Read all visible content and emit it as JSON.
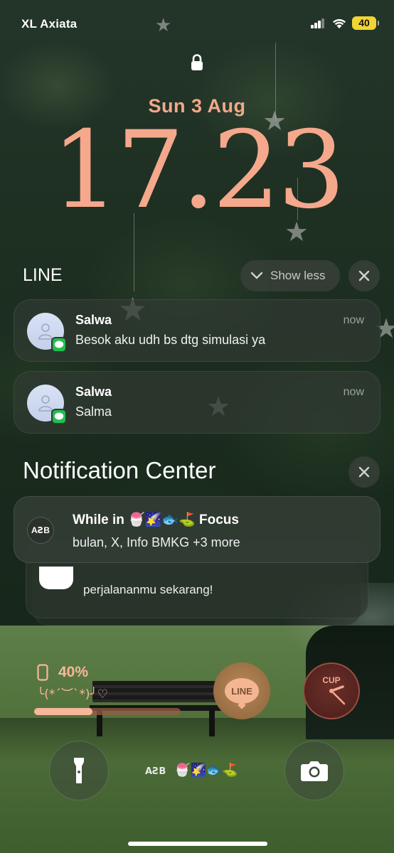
{
  "status_bar": {
    "carrier": "XL Axiata",
    "battery_level": "40"
  },
  "lock_screen": {
    "date": "Sun 3 Aug",
    "time": "17.23",
    "accent_color": "#f5a88c"
  },
  "line_group": {
    "app_name": "LINE",
    "show_less_label": "Show less",
    "notifications": [
      {
        "sender": "Salwa",
        "message": "Besok aku udh bs dtg simulasi ya",
        "time": "now"
      },
      {
        "sender": "Salwa",
        "message": "Salma",
        "time": "now"
      }
    ]
  },
  "notification_center": {
    "title": "Notification Center",
    "focus_summary": {
      "title_prefix": "While in",
      "emojis": "🍧🌠🐟⛳",
      "title_suffix": "Focus",
      "body": "bulan, X, Info BMKG +3 more",
      "icon_text": "AꙄB"
    },
    "stacked_preview": "perjalananmu sekarang!"
  },
  "widgets": {
    "battery": {
      "percent_label": "40%",
      "level": 0.4,
      "kaomoji": "╰(*´︶`*)╯♡"
    },
    "line_widget_label": "LINE",
    "clock_widget_label": "CUP"
  },
  "bottom_bar": {
    "focus_icon_text": "AꙄB",
    "focus_emojis": "🍧🌠🐟⛳"
  }
}
